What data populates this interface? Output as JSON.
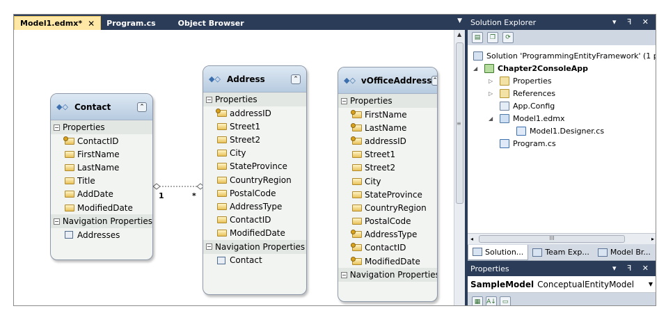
{
  "editor": {
    "tabs": [
      {
        "label": "Model1.edmx*",
        "active": true
      },
      {
        "label": "Program.cs",
        "active": false
      },
      {
        "label": "Object Browser",
        "active": false
      }
    ],
    "close_glyph": "✕",
    "menu_glyph": "▼"
  },
  "diagram": {
    "entities": [
      {
        "name": "Contact",
        "properties_label": "Properties",
        "properties": [
          {
            "name": "ContactID",
            "key": true
          },
          {
            "name": "FirstName",
            "key": false
          },
          {
            "name": "LastName",
            "key": false
          },
          {
            "name": "Title",
            "key": false
          },
          {
            "name": "AddDate",
            "key": false
          },
          {
            "name": "ModifiedDate",
            "key": false
          }
        ],
        "nav_label": "Navigation Properties",
        "navigation": [
          "Addresses"
        ]
      },
      {
        "name": "Address",
        "properties_label": "Properties",
        "properties": [
          {
            "name": "addressID",
            "key": true
          },
          {
            "name": "Street1",
            "key": false
          },
          {
            "name": "Street2",
            "key": false
          },
          {
            "name": "City",
            "key": false
          },
          {
            "name": "StateProvince",
            "key": false
          },
          {
            "name": "CountryRegion",
            "key": false
          },
          {
            "name": "PostalCode",
            "key": false
          },
          {
            "name": "AddressType",
            "key": false
          },
          {
            "name": "ContactID",
            "key": false
          },
          {
            "name": "ModifiedDate",
            "key": false
          }
        ],
        "nav_label": "Navigation Properties",
        "navigation": [
          "Contact"
        ]
      },
      {
        "name": "vOfficeAddress",
        "properties_label": "Properties",
        "properties": [
          {
            "name": "FirstName",
            "key": true
          },
          {
            "name": "LastName",
            "key": true
          },
          {
            "name": "addressID",
            "key": true
          },
          {
            "name": "Street1",
            "key": false
          },
          {
            "name": "Street2",
            "key": false
          },
          {
            "name": "City",
            "key": false
          },
          {
            "name": "StateProvince",
            "key": false
          },
          {
            "name": "CountryRegion",
            "key": false
          },
          {
            "name": "PostalCode",
            "key": false
          },
          {
            "name": "AddressType",
            "key": true
          },
          {
            "name": "ContactID",
            "key": true
          },
          {
            "name": "ModifiedDate",
            "key": true
          }
        ],
        "nav_label": "Navigation Properties",
        "navigation": []
      }
    ],
    "association": {
      "from_multiplicity": "1",
      "to_multiplicity": "*"
    }
  },
  "solution_explorer": {
    "title": "Solution Explorer",
    "title_icons": "▾ ꟻ ✕",
    "toolbar_icons": [
      "properties-icon",
      "show-all-files-icon",
      "refresh-icon"
    ],
    "items": [
      {
        "label": "Solution 'ProgrammingEntityFramework' (1 p",
        "icon": "solution-icon",
        "level": 0,
        "expander": ""
      },
      {
        "label": "Chapter2ConsoleApp",
        "icon": "project-icon",
        "level": 0,
        "expander": "◢",
        "bold": true
      },
      {
        "label": "Properties",
        "icon": "properties-folder-icon",
        "level": 1,
        "expander": "▷"
      },
      {
        "label": "References",
        "icon": "references-folder-icon",
        "level": 1,
        "expander": "▷"
      },
      {
        "label": "App.Config",
        "icon": "config-file-icon",
        "level": 1,
        "expander": ""
      },
      {
        "label": "Model1.edmx",
        "icon": "edmx-file-icon",
        "level": 1,
        "expander": "◢"
      },
      {
        "label": "Model1.Designer.cs",
        "icon": "cs-file-icon",
        "level": 2,
        "expander": ""
      },
      {
        "label": "Program.cs",
        "icon": "cs-file-icon",
        "level": 1,
        "expander": ""
      }
    ],
    "hscroll_left": "◂",
    "hscroll_right": "▸",
    "hscroll_grip": "III"
  },
  "bottom_tabs": [
    {
      "label": "Solution...",
      "active": true
    },
    {
      "label": "Team Exp...",
      "active": false
    },
    {
      "label": "Model Br...",
      "active": false
    }
  ],
  "properties_panel": {
    "title": "Properties",
    "title_icons": "▾ ꟻ ✕",
    "object_name": "SampleModel",
    "object_type": "ConceptualEntityModel",
    "dropdown_glyph": "▼"
  },
  "colors": {
    "titlebar": "#2b3c59",
    "active_tab": "#ffe8a6",
    "entity_header": "#b7cbe0"
  }
}
